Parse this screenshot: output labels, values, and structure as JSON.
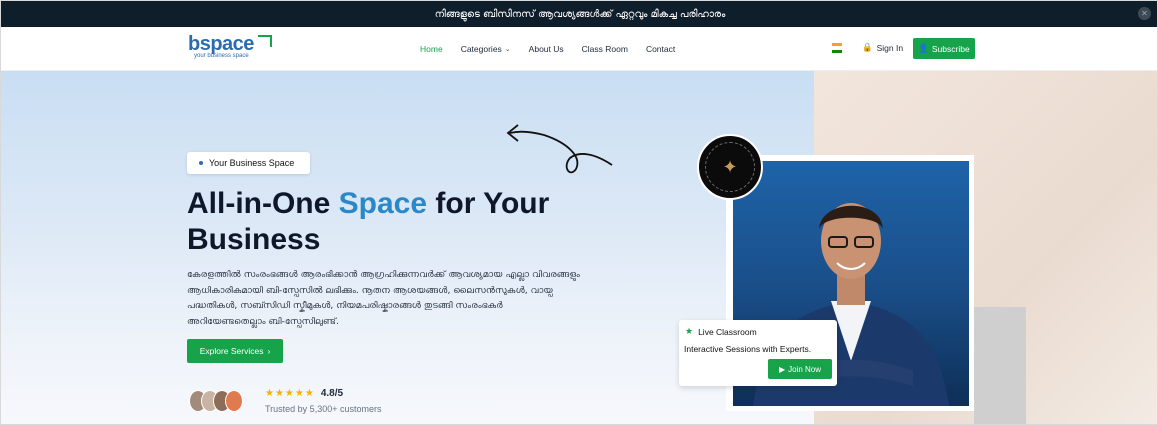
{
  "topbar": {
    "announcement": "നിങ്ങളുടെ ബിസിനസ് ആവശ്യങ്ങൾക്ക് ഏറ്റവും മികച്ച പരിഹാരം"
  },
  "brand": {
    "name_main": "bspace",
    "tagline": "your business space",
    "primary_color": "#2b6cb0",
    "accent_color": "#16a34a"
  },
  "nav": {
    "items": [
      {
        "label": "Home",
        "active": true
      },
      {
        "label": "Categories",
        "has_dropdown": true
      },
      {
        "label": "About Us"
      },
      {
        "label": "Class Room"
      },
      {
        "label": "Contact"
      }
    ],
    "signin_label": "Sign In",
    "subscribe_label": "Subscribe",
    "language_flag": "india-flag-icon"
  },
  "hero": {
    "tag_label": "Your Business Space",
    "headline_part1": "All-in-One ",
    "headline_highlight": "Space",
    "headline_part2": " for Your Business",
    "description": "കേരളത്തിൽ സംരംഭങ്ങൾ ആരംഭിക്കാൻ ആഗ്രഹിക്കുന്നവർക്ക് ആവശ്യമായ എല്ലാ വിവരങ്ങളും ആധികാരികമായി ബി-സ്പേസിൽ ലഭിക്കും. നൂതന ആശയങ്ങൾ, ലൈസൻസുകൾ, വായ്പ പദ്ധതികൾ, സബ്സിഡി സ്കീമുകൾ, നിയമപരിഷ്കാരങ്ങൾ തുടങ്ങി സംരംഭകർ അറിയേണ്ടതെല്ലാം ബി-സ്പേസിലുണ്ട്.",
    "cta_label": "Explore Services",
    "rating_stars": 5,
    "rating_value": "4.8/5",
    "trusted_text": "Trusted by 5,300+ customers"
  },
  "live_card": {
    "title": "Live Classroom",
    "subtitle": "Interactive Sessions with Experts.",
    "join_label": "Join Now"
  }
}
